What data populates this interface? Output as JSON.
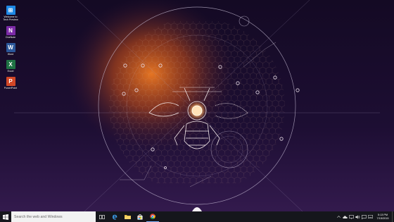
{
  "desktop": {
    "icons": [
      {
        "label": "Welcome to Tech Preview",
        "icon": "windows-icon",
        "color": "#1e88e5",
        "glyph": "⊞"
      },
      {
        "label": "OneNote",
        "icon": "onenote-icon",
        "color": "#7b2aa6",
        "glyph": "N"
      },
      {
        "label": "Word",
        "icon": "word-icon",
        "color": "#2b579a",
        "glyph": "W"
      },
      {
        "label": "Excel",
        "icon": "excel-icon",
        "color": "#1f7244",
        "glyph": "X"
      },
      {
        "label": "PowerPoint",
        "icon": "powerpoint-icon",
        "color": "#d24726",
        "glyph": "P"
      }
    ]
  },
  "taskbar": {
    "search_placeholder": "Search the web and Windows",
    "apps": [
      {
        "name": "task-view-icon"
      },
      {
        "name": "edge-icon"
      },
      {
        "name": "file-explorer-icon"
      },
      {
        "name": "store-icon"
      },
      {
        "name": "chrome-icon"
      }
    ],
    "clock": {
      "time": "5:13 PM",
      "date": "7/15/2015"
    }
  },
  "colors": {
    "taskbar": "#15161c",
    "accent_orange": "#e06a18",
    "wallpaper_top": "#160b26",
    "wallpaper_bottom": "#2b1444"
  }
}
